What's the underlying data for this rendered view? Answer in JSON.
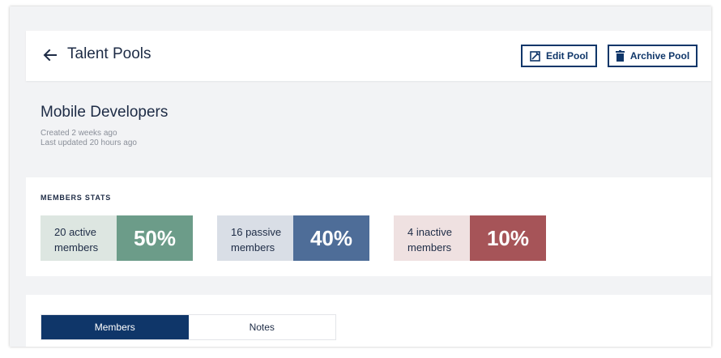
{
  "header": {
    "title": "Talent Pools",
    "back_icon": "arrow-left-icon",
    "edit_label": "Edit Pool",
    "edit_icon": "edit-icon",
    "archive_label": "Archive Pool",
    "archive_icon": "trash-icon"
  },
  "pool": {
    "name": "Mobile Developers",
    "created": "Created 2 weeks ago",
    "updated": "Last updated 20 hours ago"
  },
  "stats": {
    "heading": "MEMBERS STATS",
    "items": [
      {
        "line1": "20 active",
        "line2": "members",
        "percent": "50%",
        "light": "#dde6e1",
        "dark": "#6c9c89"
      },
      {
        "line1": "16 passive",
        "line2": "members",
        "percent": "40%",
        "light": "#d9dee6",
        "dark": "#4e6d98"
      },
      {
        "line1": "4 inactive",
        "line2": "members",
        "percent": "10%",
        "light": "#efe1e1",
        "dark": "#a65458"
      }
    ]
  },
  "tabs": [
    {
      "label": "Members",
      "active": true
    },
    {
      "label": "Notes",
      "active": false
    }
  ],
  "colors": {
    "primary": "#0f3669",
    "text": "#1d2b45",
    "muted": "#8a8f99",
    "background": "#f2f3f5"
  }
}
